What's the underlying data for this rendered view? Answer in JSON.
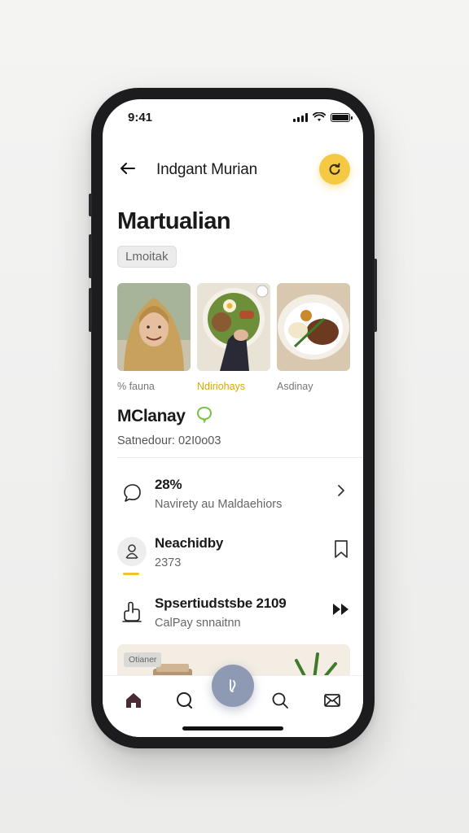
{
  "status_bar": {
    "time": "9:41"
  },
  "header": {
    "title": "Indgant Murian",
    "action_icon": "refresh-icon"
  },
  "page": {
    "title": "Martualian",
    "tag": "Lmoitak"
  },
  "gallery": {
    "captions": [
      "% fauna",
      "Ndiriohays",
      "Asdinay"
    ],
    "caption_colors": [
      "#777777",
      "#d9a800",
      "#777777"
    ]
  },
  "profile": {
    "name": "MClanay",
    "subtitle": "Satnedour: 02I0o03"
  },
  "list": [
    {
      "title": "28%",
      "subtitle": "Navirety au Maldaehiors",
      "icon": "chat-bubble-icon",
      "end_icon": "chevron-right-icon"
    },
    {
      "title": "Neachidby",
      "subtitle": "2373",
      "icon": "person-icon",
      "end_icon": "bookmark-icon"
    },
    {
      "title": "Spsertiudstsbe 2109",
      "subtitle": "CalPay snnaitnn",
      "icon": "hand-icon",
      "end_icon": "fast-forward-icon"
    }
  ],
  "banner": {
    "chip": "Otianer"
  },
  "tabbar": {
    "items": [
      "home-icon",
      "chat-icon",
      "voice-icon",
      "search-icon",
      "mail-icon"
    ]
  },
  "colors": {
    "accent": "#f6c945",
    "fab": "#8e9ab3",
    "verified": "#7bc142",
    "home": "#4a2a35"
  }
}
